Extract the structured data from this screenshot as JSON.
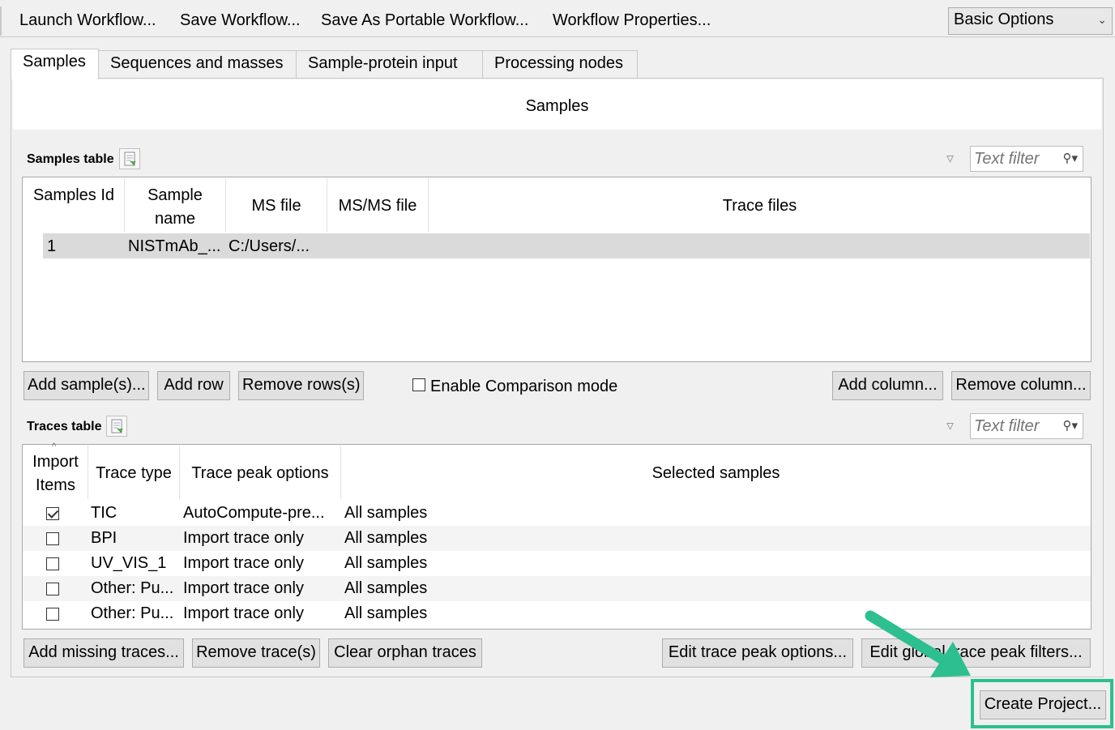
{
  "toolbar": {
    "launch": "Launch Workflow...",
    "save": "Save Workflow...",
    "save_portable": "Save As Portable Workflow...",
    "properties": "Workflow Properties...",
    "options_value": "Basic Options"
  },
  "tabs": [
    "Samples",
    "Sequences and masses",
    "Sample-protein input",
    "Processing nodes"
  ],
  "samples_section": {
    "header": "Samples",
    "table_label": "Samples table",
    "filter_placeholder": "Text filter",
    "columns": [
      "Samples Id",
      "Sample name",
      "MS file",
      "MS/MS file",
      "Trace files"
    ],
    "rows": [
      {
        "id": "1",
        "name": "NISTmAb_...",
        "ms_file": "C:/Users/...",
        "msms_file": "",
        "trace_files": ""
      }
    ],
    "buttons": {
      "add_samples": "Add sample(s)...",
      "add_row": "Add row",
      "remove_rows": "Remove rows(s)",
      "comparison": "Enable Comparison mode",
      "add_column": "Add column...",
      "remove_column": "Remove column..."
    }
  },
  "traces_section": {
    "table_label": "Traces table",
    "filter_placeholder": "Text filter",
    "columns": [
      "Import Items",
      "Trace type",
      "Trace peak options",
      "Selected samples"
    ],
    "rows": [
      {
        "checked": true,
        "type": "TIC",
        "options": "AutoCompute-pre...",
        "samples": "All samples"
      },
      {
        "checked": false,
        "type": "BPI",
        "options": "Import trace only",
        "samples": "All samples"
      },
      {
        "checked": false,
        "type": "UV_VIS_1",
        "options": "Import trace only",
        "samples": "All samples"
      },
      {
        "checked": false,
        "type": "Other: Pu...",
        "options": "Import trace only",
        "samples": "All samples"
      },
      {
        "checked": false,
        "type": "Other: Pu...",
        "options": "Import trace only",
        "samples": "All samples"
      }
    ],
    "buttons": {
      "add_missing": "Add missing traces...",
      "remove_traces": "Remove trace(s)",
      "clear_orphan": "Clear orphan traces",
      "edit_peak": "Edit trace peak options...",
      "edit_global": "Edit global trace peak filters..."
    }
  },
  "create_project": "Create Project...",
  "colors": {
    "highlight": "#2dbf8f"
  }
}
